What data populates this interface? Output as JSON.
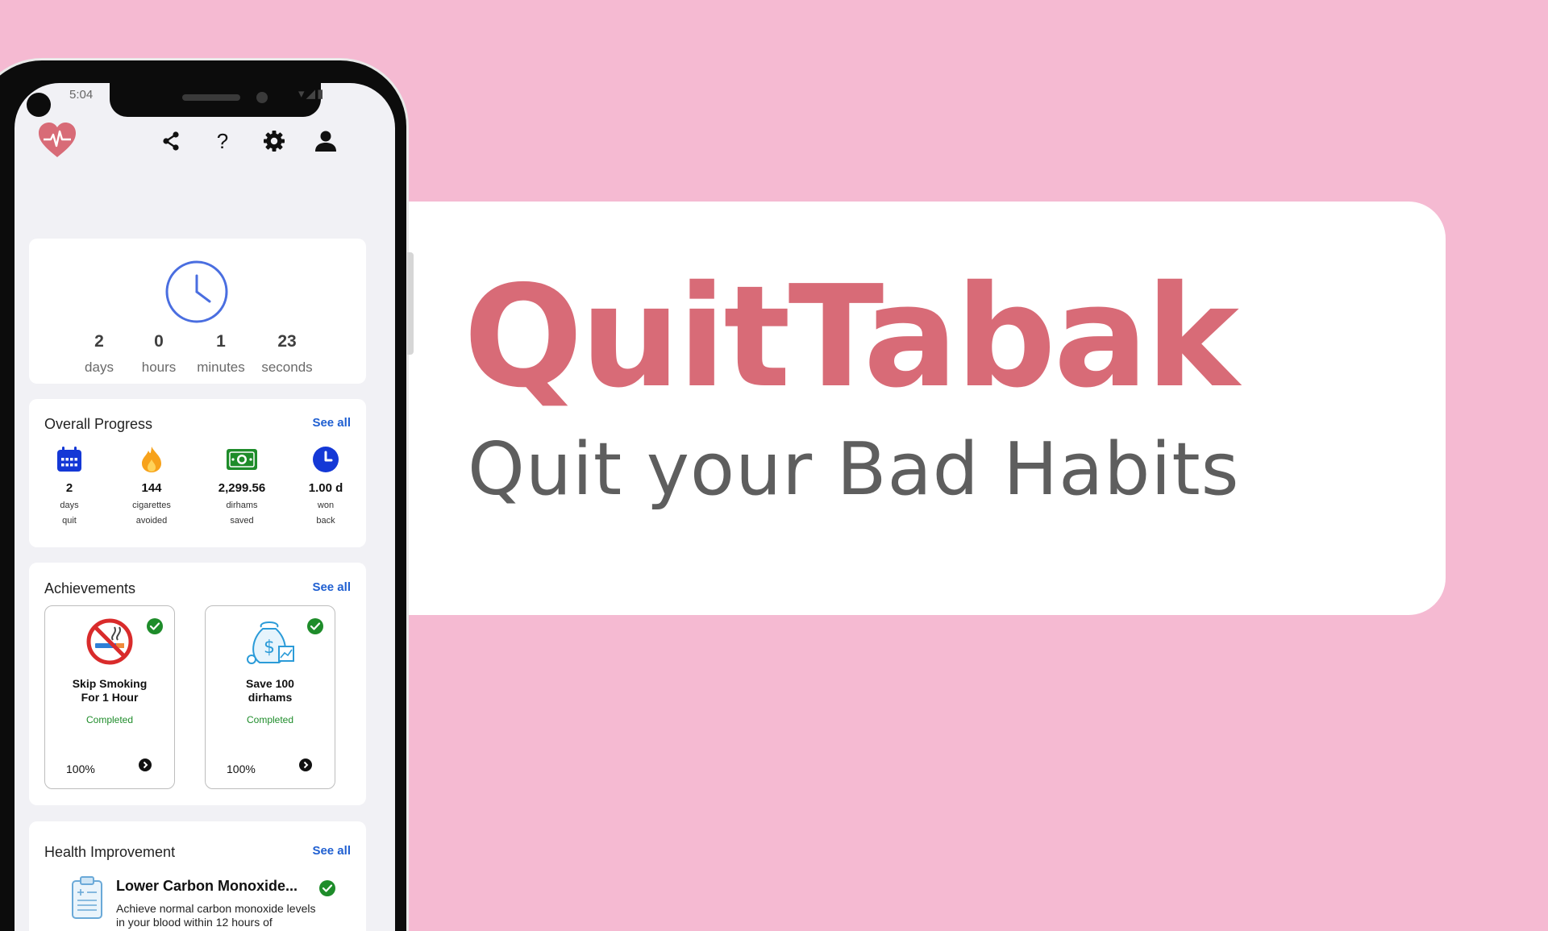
{
  "brand": {
    "title": "QuitTabak",
    "subtitle": "Quit your Bad Habits"
  },
  "status_bar": {
    "time": "5:04",
    "icons": "▾◢▮"
  },
  "toolbar": {
    "icons": [
      "heart-pulse-icon",
      "share-icon",
      "help-icon",
      "gear-icon",
      "person-icon"
    ],
    "help_glyph": "?"
  },
  "timer": {
    "icon": "clock-icon",
    "units": [
      {
        "value": "2",
        "label": "days"
      },
      {
        "value": "0",
        "label": "hours"
      },
      {
        "value": "1",
        "label": "minutes"
      },
      {
        "value": "23",
        "label": "seconds"
      }
    ]
  },
  "overall_progress": {
    "title": "Overall Progress",
    "see_all": "See all",
    "stats": [
      {
        "icon": "calendar-icon",
        "value": "2",
        "label1": "days",
        "label2": "quit"
      },
      {
        "icon": "flame-icon",
        "value": "144",
        "label1": "cigarettes",
        "label2": "avoided"
      },
      {
        "icon": "money-icon",
        "value": "2,299.56",
        "label1": "dirhams",
        "label2": "saved"
      },
      {
        "icon": "time-icon",
        "value": "1.00 d",
        "label1": "won",
        "label2": "back"
      }
    ]
  },
  "achievements": {
    "title": "Achievements",
    "see_all": "See all",
    "items": [
      {
        "icon": "no-smoking-icon",
        "title_line1": "Skip Smoking",
        "title_line2": "For 1 Hour",
        "status": "Completed",
        "percent": "100%",
        "progress": 1.0
      },
      {
        "icon": "money-bag-icon",
        "title_line1": "Save 100",
        "title_line2": "dirhams",
        "status": "Completed",
        "percent": "100%",
        "progress": 1.0
      }
    ]
  },
  "health_improvement": {
    "title": "Health Improvement",
    "see_all": "See all",
    "item": {
      "icon": "clipboard-icon",
      "title": "Lower Carbon Monoxide...",
      "description": "Achieve normal carbon monoxide levels in your blood within 12 hours of"
    }
  },
  "colors": {
    "background": "#f5bad2",
    "brand": "#d86b77",
    "subtitle": "#5e5e5e",
    "link": "#1f5fd1",
    "completed": "#1e8c2a"
  }
}
